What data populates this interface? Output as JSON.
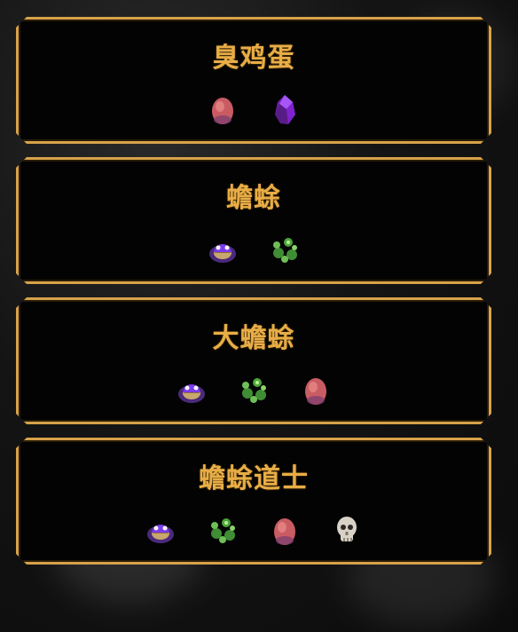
{
  "cards": [
    {
      "title": "臭鸡蛋",
      "icons": [
        "egg-icon",
        "purple-crystal-icon"
      ]
    },
    {
      "title": "蟾蜍",
      "icons": [
        "toad-icon",
        "green-slime-icon"
      ]
    },
    {
      "title": "大蟾蜍",
      "icons": [
        "toad-icon",
        "green-slime-icon",
        "egg-icon"
      ]
    },
    {
      "title": "蟾蜍道士",
      "icons": [
        "toad-icon",
        "green-slime-icon",
        "egg-icon",
        "skull-icon"
      ]
    }
  ],
  "colors": {
    "accent": "#d7a24a",
    "title": "#e8ad46",
    "card_bg": "#030303"
  }
}
